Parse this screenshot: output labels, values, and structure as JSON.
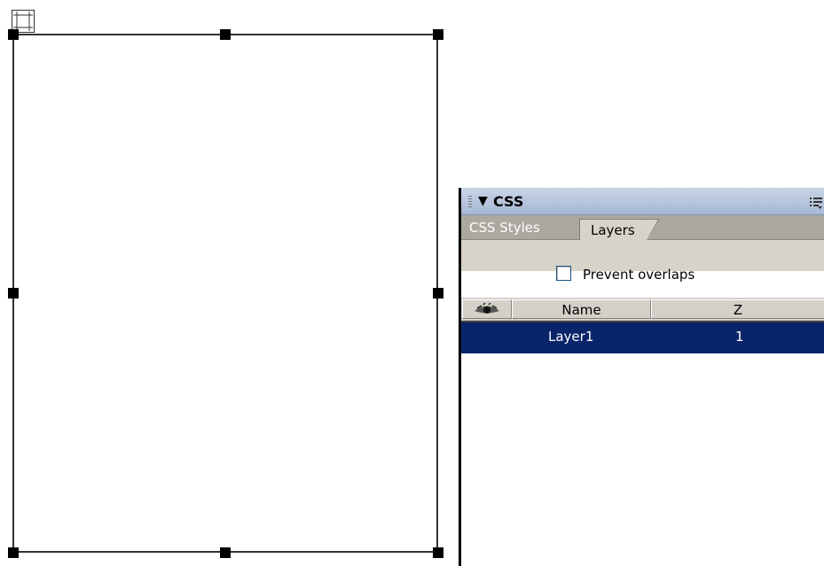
{
  "panel": {
    "title": "CSS",
    "collapse_arrow": "▼",
    "icons": [
      "panel-grip-icon",
      "collapse-triangle-icon",
      "panel-options-menu-icon",
      "visibility-eye-icon",
      "layer-selection-tab-icon"
    ],
    "tabs": [
      {
        "label": "CSS Styles",
        "active": false
      },
      {
        "label": "Layers",
        "active": true
      }
    ],
    "prevent_overlaps": {
      "label": "Prevent overlaps",
      "checked": false
    },
    "columns": {
      "visibility": "",
      "name": "Name",
      "z": "Z"
    },
    "rows": [
      {
        "name": "Layer1",
        "z": "1",
        "selected": true
      }
    ]
  },
  "colors": {
    "selection": "#0a246a",
    "panel_title_bg": "#a8b8d3",
    "tab_strip_bg": "#ada89f",
    "panel_body_bg": "#d8d3c8"
  }
}
